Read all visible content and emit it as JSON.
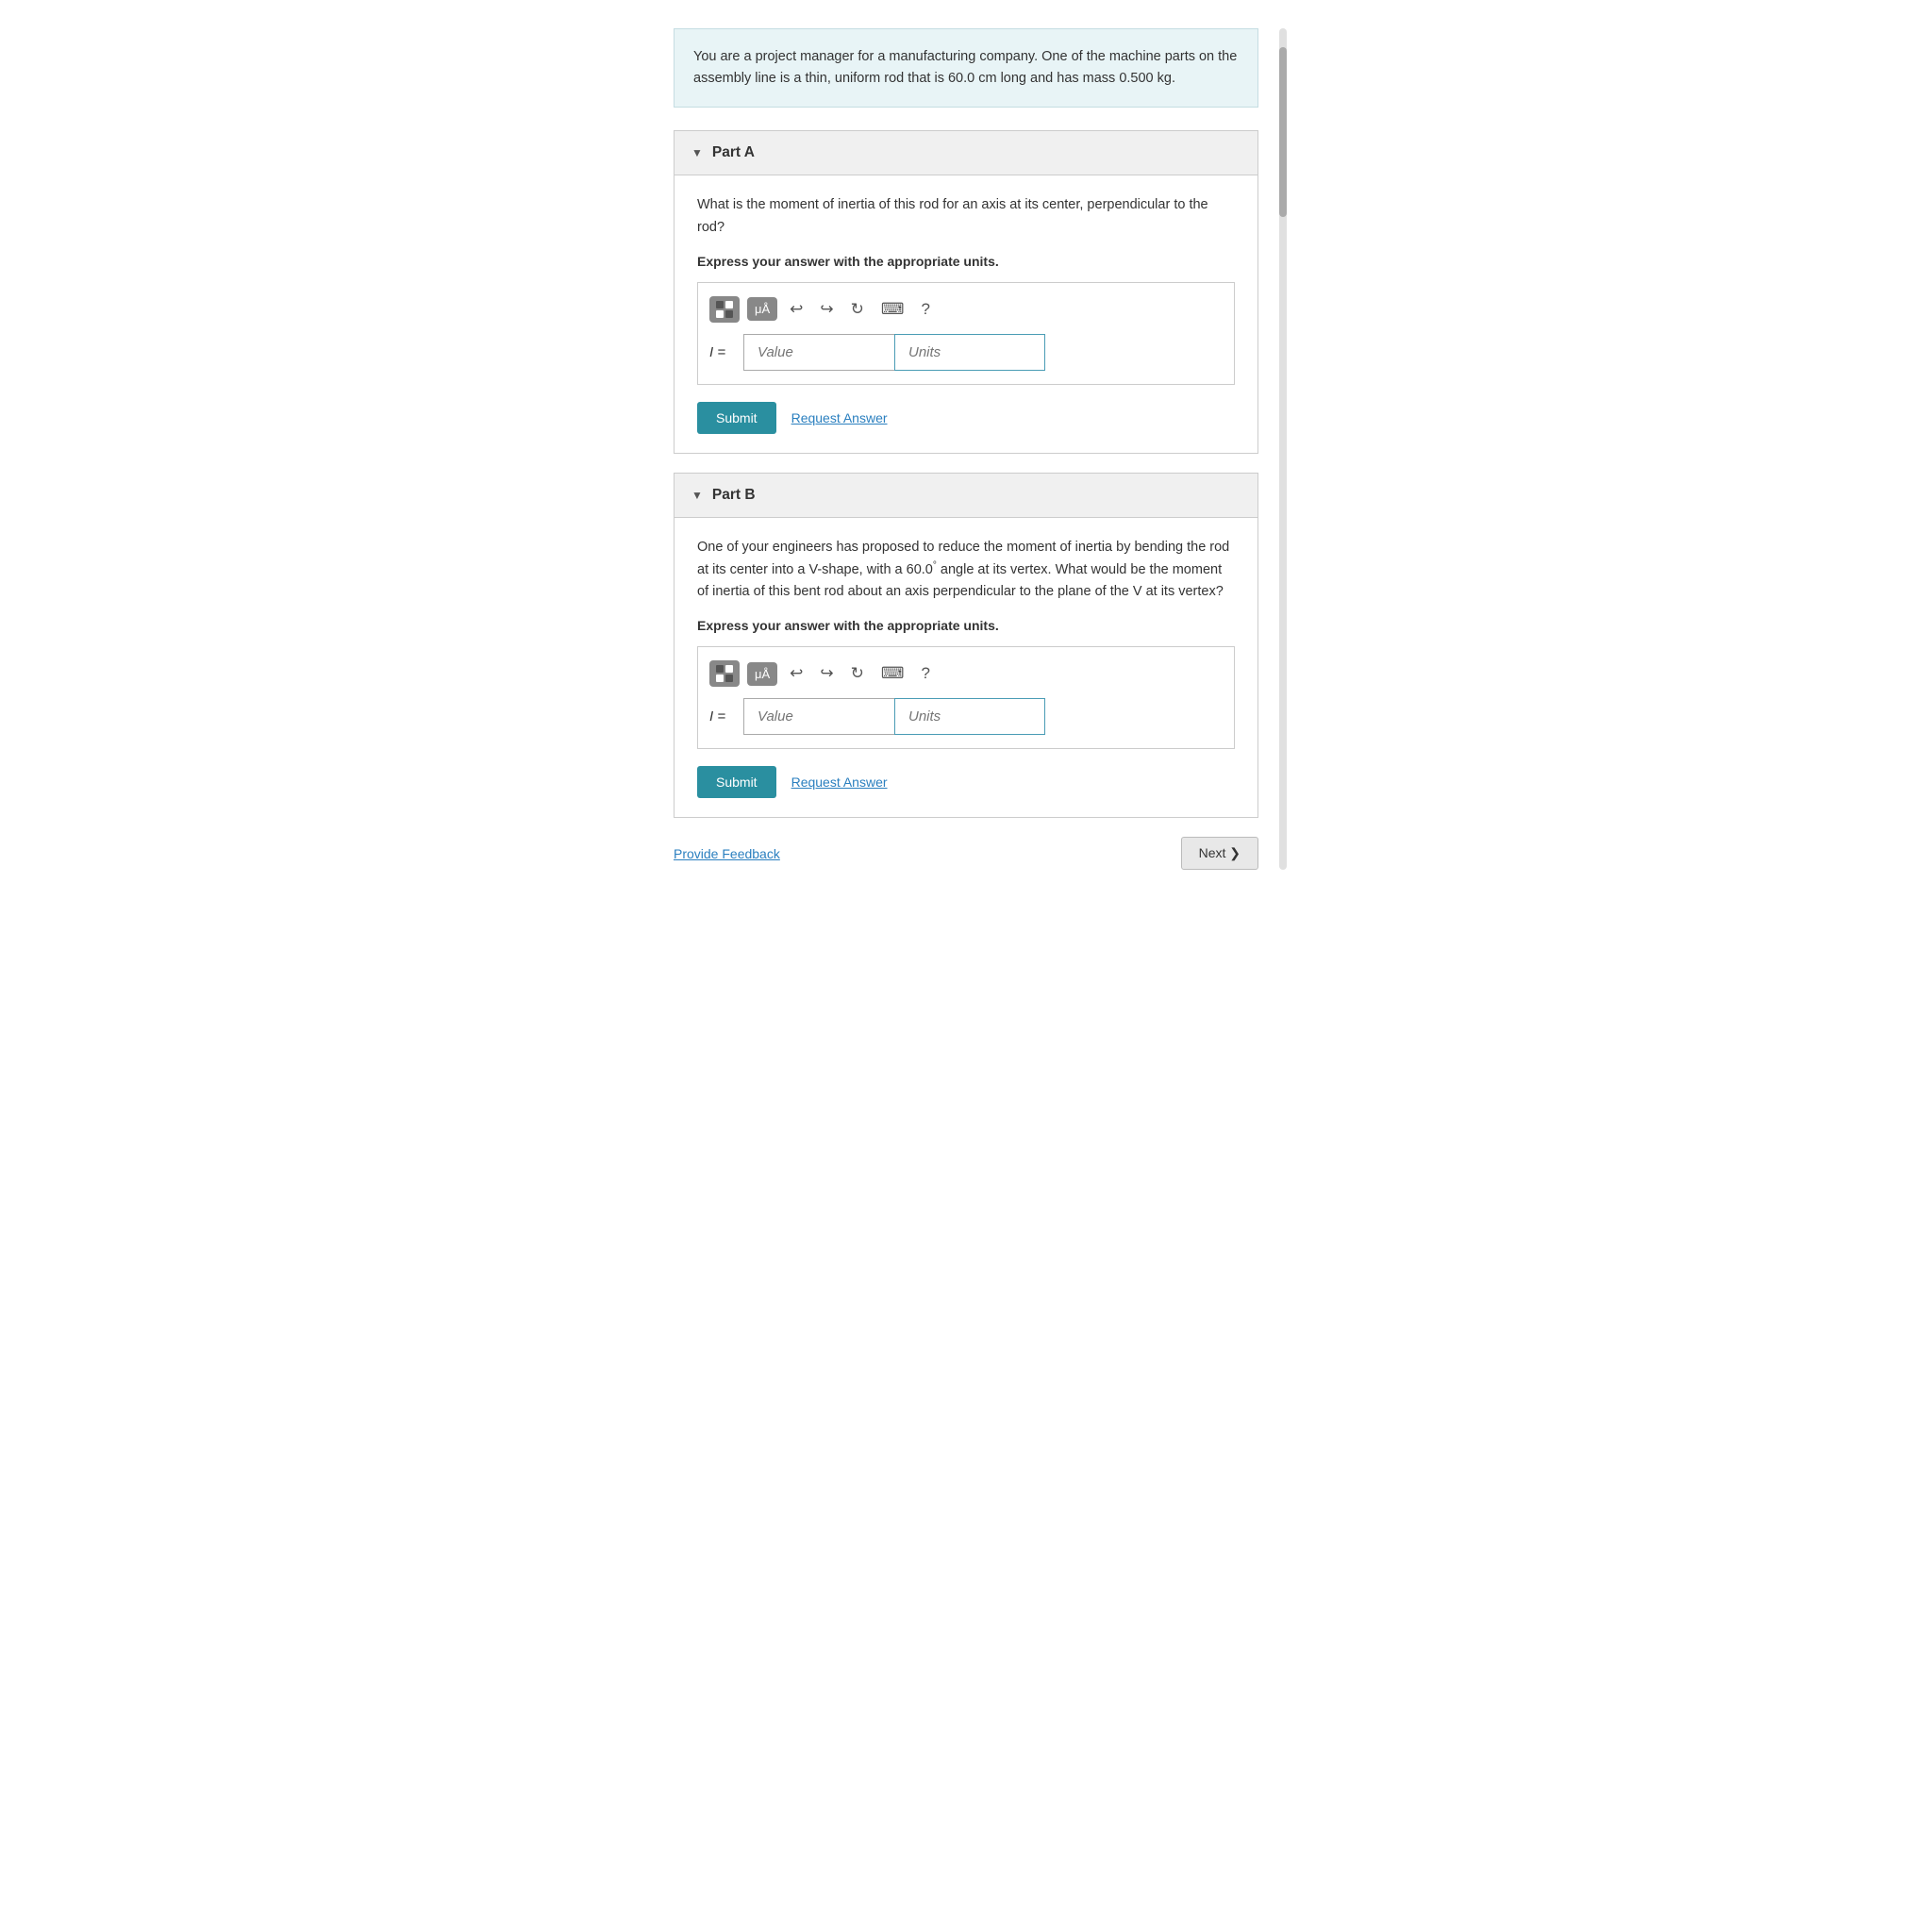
{
  "intro": {
    "text": "You are a project manager for a manufacturing company. One of the machine parts on the assembly line is a thin, uniform rod that is 60.0 cm long and has mass 0.500 kg."
  },
  "partA": {
    "header": "Part A",
    "question": "What is the moment of inertia of this rod for an axis at its center, perpendicular to the rod?",
    "express_label": "Express your answer with the appropriate units.",
    "input_label": "I =",
    "value_placeholder": "Value",
    "units_placeholder": "Units",
    "submit_label": "Submit",
    "request_answer_label": "Request Answer"
  },
  "partB": {
    "header": "Part B",
    "question": "One of your engineers has proposed to reduce the moment of inertia by bending the rod at its center into a V-shape, with a 60.0° angle at its vertex. What would be the moment of inertia of this bent rod about an axis perpendicular to the plane of the V at its vertex?",
    "express_label": "Express your answer with the appropriate units.",
    "input_label": "I =",
    "value_placeholder": "Value",
    "units_placeholder": "Units",
    "submit_label": "Submit",
    "request_answer_label": "Request Answer"
  },
  "footer": {
    "feedback_label": "Provide Feedback",
    "next_label": "Next ❯"
  },
  "toolbar": {
    "matrix_label": "matrix",
    "mu_label": "μÅ",
    "undo_icon": "↩",
    "redo_icon": "↪",
    "refresh_icon": "↻",
    "keyboard_icon": "⌨",
    "help_icon": "?"
  }
}
